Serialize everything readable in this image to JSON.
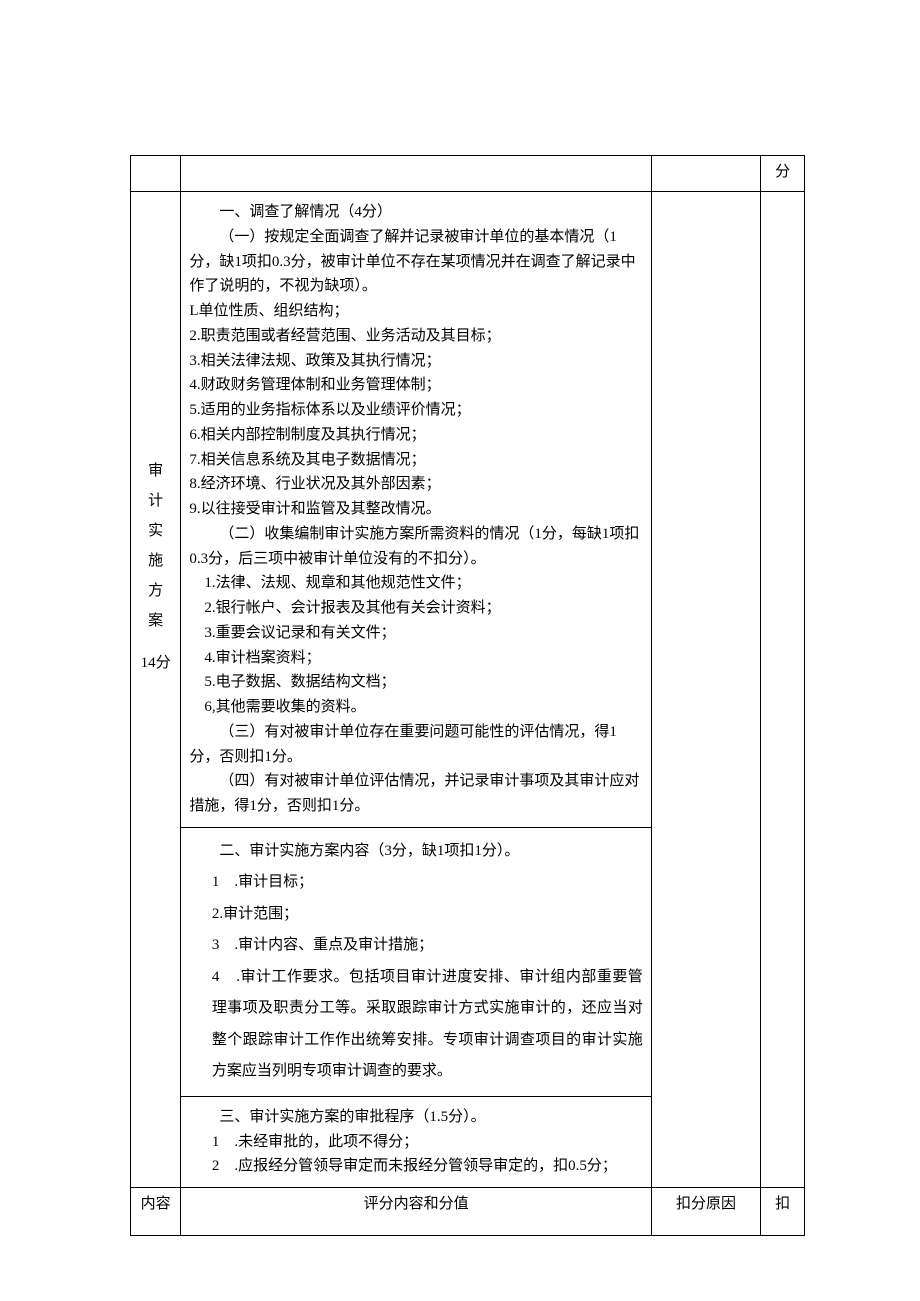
{
  "top_right_cell": "分",
  "section_a": {
    "col_label_chars": [
      "审",
      "计",
      "实",
      "施",
      "方",
      "案"
    ],
    "col_score": "14分",
    "title": "一、调查了解情况（4分）",
    "sub1_intro": "（一）按规定全面调查了解并记录被审计单位的基本情况（1分，缺1项扣0.3分，被审计单位不存在某项情况并在调查了解记录中作了说明的，不视为缺项）。",
    "items1": [
      "L单位性质、组织结构；",
      "2.职责范围或者经营范围、业务活动及其目标；",
      "3.相关法律法规、政策及其执行情况；",
      "4.财政财务管理体制和业务管理体制；",
      "5.适用的业务指标体系以及业绩评价情况；",
      "6.相关内部控制制度及其执行情况；",
      "7.相关信息系统及其电子数据情况；",
      "8.经济环境、行业状况及其外部因素；",
      "9.以往接受审计和监管及其整改情况。"
    ],
    "sub2_intro": "（二）收集编制审计实施方案所需资料的情况（1分，每缺1项扣0.3分，后三项中被审计单位没有的不扣分）。",
    "items2": [
      "1.法律、法规、规章和其他规范性文件；",
      "2.银行帐户、会计报表及其他有关会计资料；",
      "3.重要会议记录和有关文件；",
      "4.审计档案资料；",
      "5.电子数据、数据结构文档；",
      "6,其他需要收集的资料。"
    ],
    "sub3": "（三）有对被审计单位存在重要问题可能性的评估情况，得1分，否则扣1分。",
    "sub4": "（四）有对被审计单位评估情况，并记录审计事项及其审计应对措施，得1分，否则扣1分。"
  },
  "section_b": {
    "title": "二、审计实施方案内容（3分，缺1项扣1分）。",
    "item1_num": "1",
    "item1_text": ".审计目标；",
    "item2": "2.审计范围；",
    "item3_num": "3",
    "item3_text": ".审计内容、重点及审计措施；",
    "item4_num": "4",
    "item4_text": ".审计工作要求。包括项目审计进度安排、审计组内部重要管理事项及职责分工等。采取跟踪审计方式实施审计的，还应当对整个跟踪审计工作作出统筹安排。专项审计调查项目的审计实施方案应当列明专项审计调查的要求。"
  },
  "section_c": {
    "title": "三、审计实施方案的审批程序（1.5分）。",
    "item1_num": "1",
    "item1_text": ".未经审批的，此项不得分；",
    "item2_num": "2",
    "item2_text": ".应报经分管领导审定而未报经分管领导审定的，扣0.5分；"
  },
  "footer": {
    "c1": "内容",
    "c2": "评分内容和分值",
    "c3": "扣分原因",
    "c4": "扣"
  }
}
